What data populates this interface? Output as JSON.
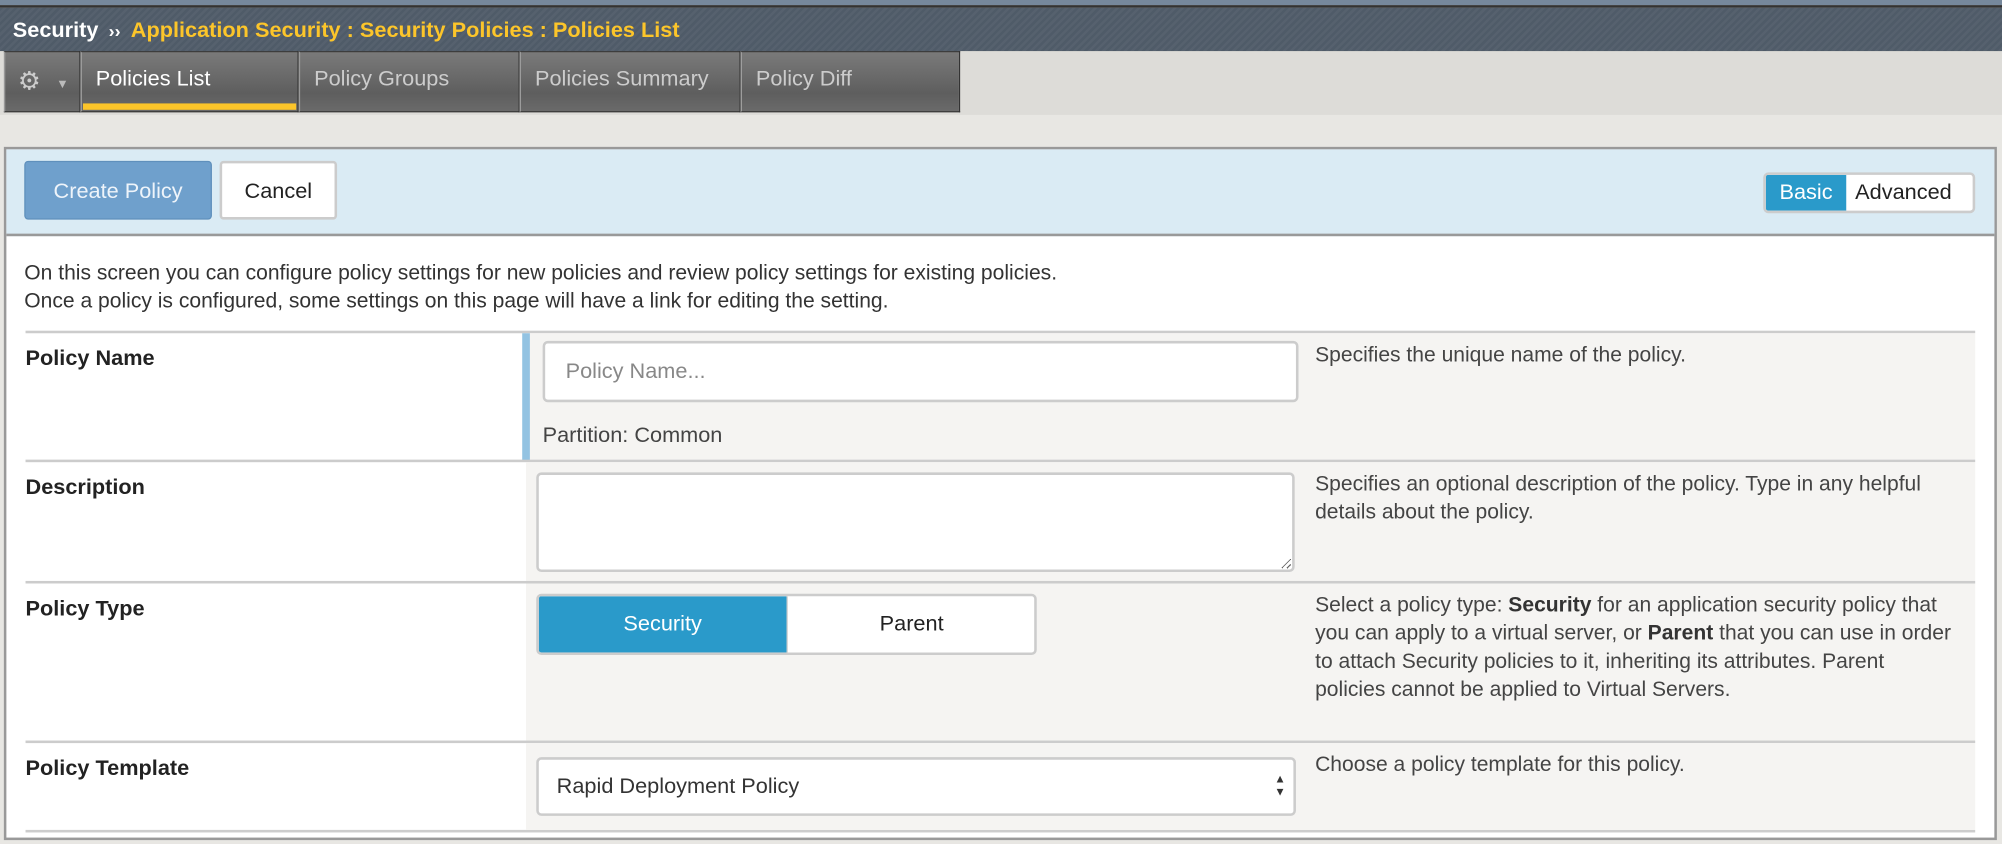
{
  "header": {
    "root": "Security",
    "separator": "››",
    "path": "Application Security : Security Policies : Policies List"
  },
  "tabs": [
    {
      "label": "Policies List",
      "active": true
    },
    {
      "label": "Policy Groups"
    },
    {
      "label": "Policies Summary"
    },
    {
      "label": "Policy Diff"
    }
  ],
  "toolbar": {
    "create_label": "Create Policy",
    "cancel_label": "Cancel",
    "basic_label": "Basic",
    "advanced_label": "Advanced",
    "mode": "Basic"
  },
  "intro": {
    "line1": "On this screen you can configure policy settings for new policies and review policy settings for existing policies.",
    "line2": "Once a policy is configured, some settings on this page will have a link for editing the setting."
  },
  "policy_name": {
    "label": "Policy Name",
    "value": "",
    "placeholder": "Policy Name...",
    "partition": "Partition: Common",
    "help": "Specifies the unique name of the policy."
  },
  "description": {
    "label": "Description",
    "value": "",
    "help": "Specifies an optional description of the policy. Type in any helpful details about the policy."
  },
  "policy_type": {
    "label": "Policy Type",
    "options": [
      "Security",
      "Parent"
    ],
    "selected": "Security",
    "help": {
      "p1": "Select a policy type: ",
      "b1": "Security",
      "p2": " for an application security policy that you can apply to a virtual server, or ",
      "b2": "Parent",
      "p3": " that you can use in order to attach Security policies to it, inheriting its attributes. Parent policies cannot be applied to Virtual Servers."
    }
  },
  "policy_template": {
    "label": "Policy Template",
    "selected": "Rapid Deployment Policy",
    "help": "Choose a policy template for this policy."
  },
  "colors": {
    "accent": "#2a9aca",
    "tab_underline": "#fcc52a",
    "toolbar_bg": "#daebf4",
    "create_button": "#6fa0cc"
  }
}
